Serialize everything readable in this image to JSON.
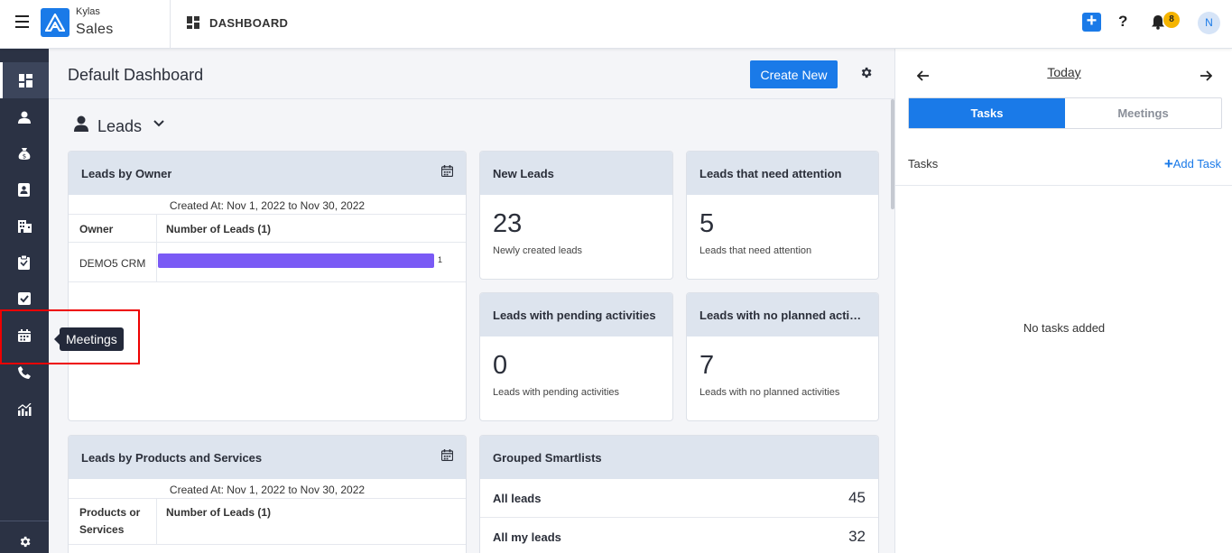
{
  "topbar": {
    "brand_top": "Kylas",
    "brand_main": "Sales",
    "section_title": "DASHBOARD",
    "add_label": "+",
    "help_label": "?",
    "notification_count": "8",
    "avatar_initial": "N",
    "accent_color": "#1a7ae8"
  },
  "sidebar": {
    "items": [
      {
        "icon": "dashboard-icon",
        "active": true
      },
      {
        "icon": "user-icon"
      },
      {
        "icon": "money-bag-icon"
      },
      {
        "icon": "contact-card-icon"
      },
      {
        "icon": "building-icon"
      },
      {
        "icon": "clipboard-icon"
      },
      {
        "icon": "checkbox-icon"
      },
      {
        "icon": "calendar-icon",
        "tooltip": "Meetings"
      },
      {
        "icon": "phone-icon"
      },
      {
        "icon": "report-chart-icon"
      }
    ],
    "bottom_icon": "settings-icon"
  },
  "main": {
    "title": "Default Dashboard",
    "create_button": "Create New",
    "section": "Leads",
    "leads_by_owner": {
      "title": "Leads by Owner",
      "created_at": "Created At: Nov 1, 2022 to Nov 30, 2022",
      "col_owner": "Owner",
      "col_count": "Number of Leads (1)",
      "rows": [
        {
          "owner": "DEMO5 CRM",
          "value": 1,
          "value_label": "1",
          "bar_fraction": 1.0
        }
      ]
    },
    "new_leads": {
      "title": "New Leads",
      "value": "23",
      "sub": "Newly created leads"
    },
    "attention": {
      "title": "Leads that need attention",
      "value": "5",
      "sub": "Leads that need attention"
    },
    "pending": {
      "title": "Leads with pending activities",
      "value": "0",
      "sub": "Leads with pending activities"
    },
    "no_planned": {
      "title": "Leads with no planned activities",
      "value": "7",
      "sub": "Leads with no planned activities"
    },
    "leads_by_products": {
      "title": "Leads by Products and Services",
      "created_at": "Created At: Nov 1, 2022 to Nov 30, 2022",
      "col_products_1": "Products or",
      "col_products_2": "Services",
      "col_count": "Number of Leads (1)"
    },
    "smartlists": {
      "title": "Grouped Smartlists",
      "rows": [
        {
          "label": "All leads",
          "count": "45"
        },
        {
          "label": "All my leads",
          "count": "32"
        }
      ]
    }
  },
  "right_panel": {
    "date_label": "Today",
    "tab_tasks": "Tasks",
    "tab_meetings": "Meetings",
    "tasks_label": "Tasks",
    "add_task": "Add Task",
    "add_task_plus": "+",
    "empty_text": "No tasks added"
  },
  "tooltip": {
    "text": "Meetings"
  },
  "bar_color": "#7a5af5"
}
